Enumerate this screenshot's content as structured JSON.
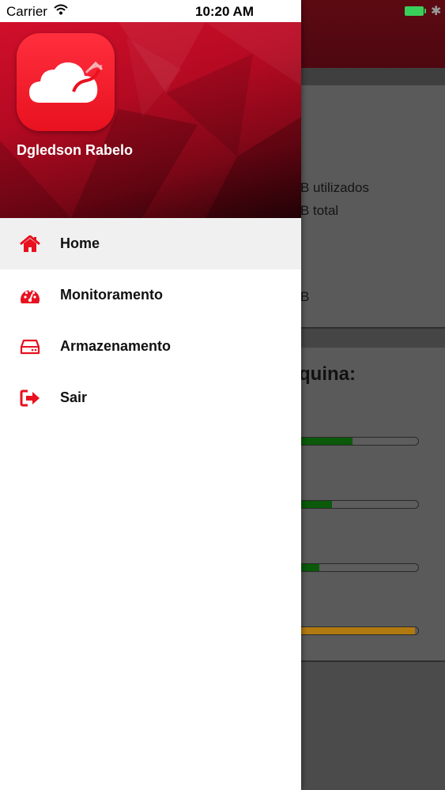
{
  "status_bar": {
    "carrier": "Carrier",
    "time": "10:20 AM"
  },
  "drawer": {
    "user_name": "Dgledson Rabelo",
    "logo_icon": "cloud-upload-icon",
    "accent_color": "#e8111f",
    "items": [
      {
        "label": "Home",
        "icon": "home-icon",
        "active": true
      },
      {
        "label": "Monitoramento",
        "icon": "speedometer-icon",
        "active": false
      },
      {
        "label": "Armazenamento",
        "icon": "hard-drive-icon",
        "active": false
      },
      {
        "label": "Sair",
        "icon": "sign-out-icon",
        "active": false
      }
    ]
  },
  "background": {
    "storage": {
      "used_text": "B utilizados",
      "total_text": "B total",
      "free_text": "B"
    },
    "machine": {
      "title": "quina:",
      "bars": [
        {
          "value": 0.58,
          "color": "#0a5a0a"
        },
        {
          "value": 0.45,
          "color": "#0a5a0a"
        },
        {
          "value": 0.37,
          "color": "#0a5a0a"
        },
        {
          "value": 0.98,
          "color": "#b07a10"
        }
      ]
    }
  }
}
